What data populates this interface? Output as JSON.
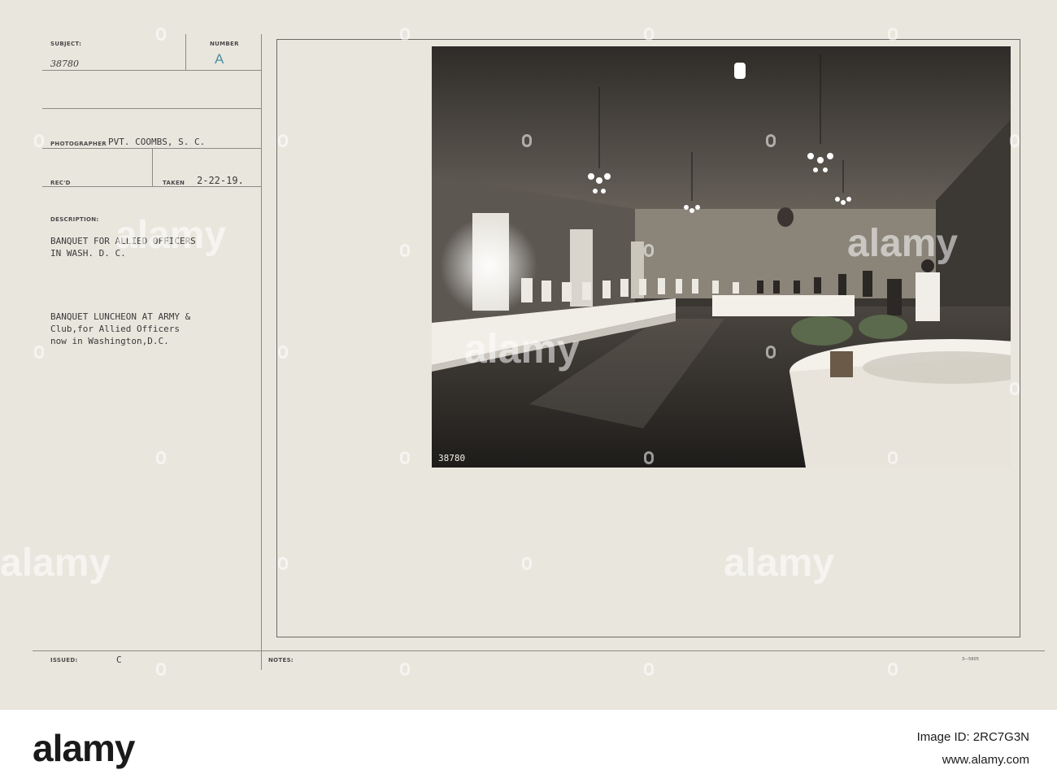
{
  "card": {
    "subject_label": "SUBJECT:",
    "subject_value": "38780",
    "number_label": "NUMBER",
    "number_value": "A",
    "photographer_label": "PHOTOGRAPHER",
    "photographer_value": "PVT. COOMBS, S. C.",
    "recd_label": "REC'D",
    "taken_label": "TAKEN",
    "taken_value": "2-22-19.",
    "description_label": "DESCRIPTION:",
    "description_line1": "BANQUET FOR ALLIED OFFICERS",
    "description_line2": "IN WASH. D. C.",
    "caption_line1": "BANQUET LUNCHEON AT ARMY &",
    "caption_line2": "Club,for Allied Officers",
    "caption_line3": "now in Washington,D.C.",
    "issued_label": "ISSUED:",
    "issued_value": "C",
    "notes_label": "NOTES:",
    "form_code": "3—5605"
  },
  "photo": {
    "negative_number": "38780",
    "description": "Banquet hall interior with long tables, chandeliers, and a row of cooks and waiters"
  },
  "watermark": {
    "text": "alamy"
  },
  "footer": {
    "logo": "alamy",
    "image_id": "Image ID: 2RC7G3N",
    "url": "www.alamy.com"
  },
  "colors": {
    "card": "#e9e6dd",
    "stamp": "#4a8fa0",
    "photo_dark": "#3a3632"
  }
}
